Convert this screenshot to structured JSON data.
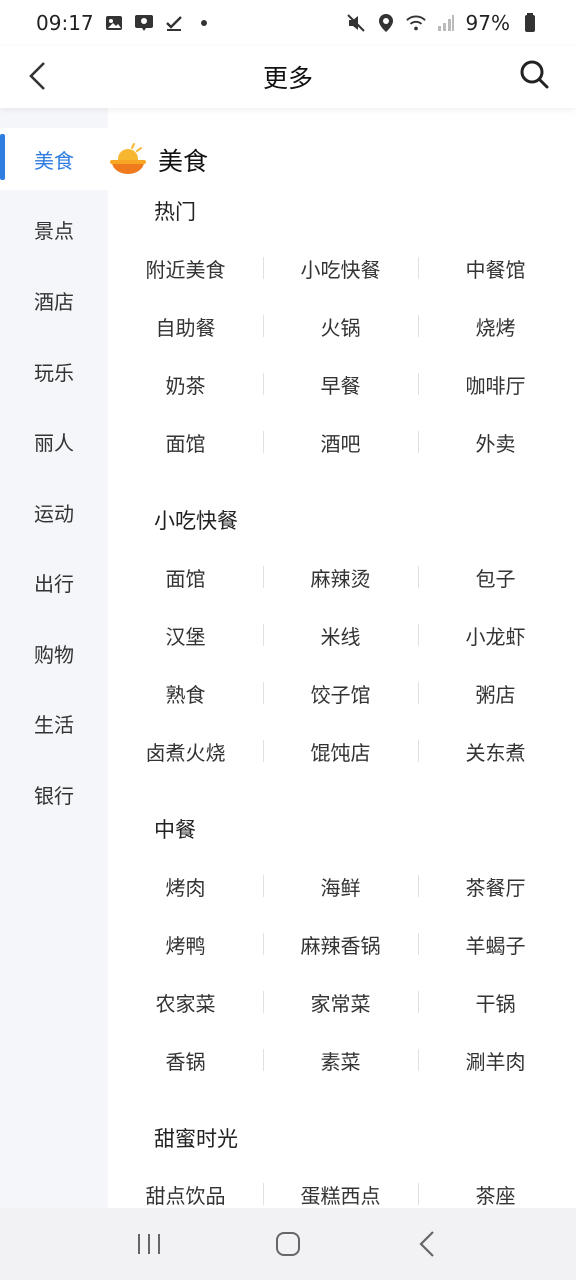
{
  "status_bar": {
    "time": "09:17",
    "battery": "97%"
  },
  "header": {
    "title": "更多"
  },
  "sidebar": {
    "items": [
      {
        "label": "美食",
        "active": true
      },
      {
        "label": "景点"
      },
      {
        "label": "酒店"
      },
      {
        "label": "玩乐"
      },
      {
        "label": "丽人"
      },
      {
        "label": "运动"
      },
      {
        "label": "出行"
      },
      {
        "label": "购物"
      },
      {
        "label": "生活"
      },
      {
        "label": "银行"
      }
    ]
  },
  "main": {
    "category": {
      "title": "美食",
      "icon": "food-bowl-icon"
    },
    "sections": [
      {
        "title": "热门",
        "items": [
          "附近美食",
          "小吃快餐",
          "中餐馆",
          "自助餐",
          "火锅",
          "烧烤",
          "奶茶",
          "早餐",
          "咖啡厅",
          "面馆",
          "酒吧",
          "外卖"
        ]
      },
      {
        "title": "小吃快餐",
        "items": [
          "面馆",
          "麻辣烫",
          "包子",
          "汉堡",
          "米线",
          "小龙虾",
          "熟食",
          "饺子馆",
          "粥店",
          "卤煮火烧",
          "馄饨店",
          "关东煮"
        ]
      },
      {
        "title": "中餐",
        "items": [
          "烤肉",
          "海鲜",
          "茶餐厅",
          "烤鸭",
          "麻辣香锅",
          "羊蝎子",
          "农家菜",
          "家常菜",
          "干锅",
          "香锅",
          "素菜",
          "涮羊肉"
        ]
      },
      {
        "title": "甜蜜时光",
        "items": [
          "甜点饮品",
          "蛋糕西点",
          "茶座"
        ]
      }
    ]
  },
  "colors": {
    "accent": "#2f7de1",
    "sidebar_bg": "#f4f6f9"
  }
}
